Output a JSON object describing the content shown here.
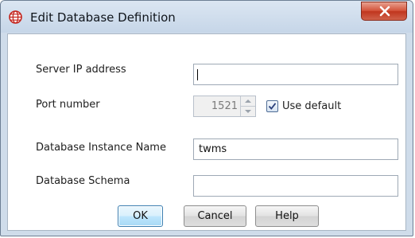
{
  "window": {
    "title": "Edit Database Definition",
    "icon": "globe-database-icon",
    "close_icon": "close-x-icon",
    "accent_close": "#c7402a",
    "title_bar_color": "#cfdcea"
  },
  "form": {
    "server_ip_label": "Server IP address",
    "server_ip_value": "",
    "port_label": "Port number",
    "port_value": "1521",
    "use_default_label": "Use default",
    "use_default_checked": true,
    "instance_label": "Database Instance Name",
    "instance_value": "twms",
    "schema_label": "Database Schema",
    "schema_value": ""
  },
  "buttons": {
    "ok": "OK",
    "cancel": "Cancel",
    "help": "Help"
  }
}
